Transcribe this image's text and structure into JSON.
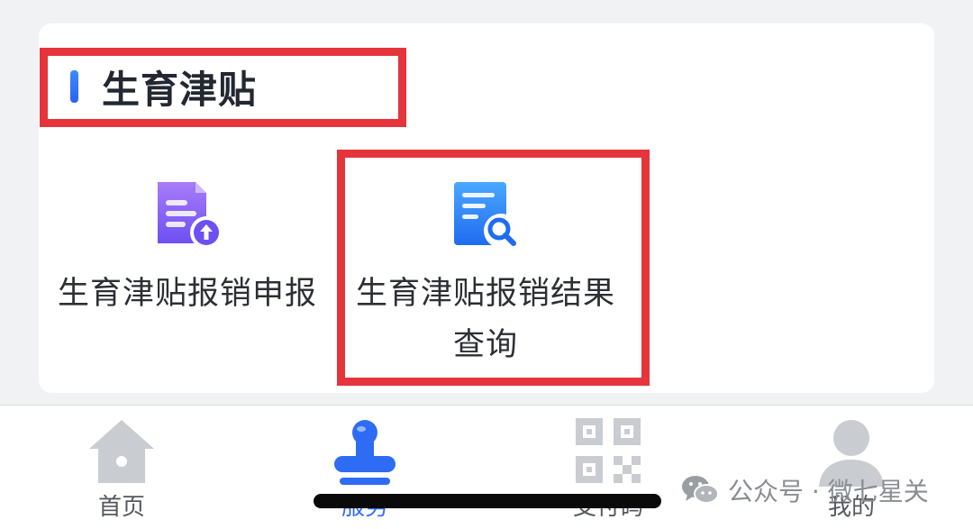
{
  "section": {
    "title": "生育津贴"
  },
  "services": [
    {
      "label": "生育津贴报销申报",
      "icon": "document-upload-icon"
    },
    {
      "label": "生育津贴报销结果查询",
      "icon": "document-search-icon"
    }
  ],
  "tabs": [
    {
      "label": "首页",
      "icon": "home-icon",
      "active": false
    },
    {
      "label": "服务",
      "icon": "stamp-icon",
      "active": true
    },
    {
      "label": "支付码",
      "icon": "qrcode-icon",
      "active": false
    },
    {
      "label": "我的",
      "icon": "user-icon",
      "active": false
    }
  ],
  "watermark": {
    "text": "公众号 · 微七星关",
    "icon": "wechat-icon"
  },
  "colors": {
    "accent": "#2f6cf4",
    "highlight": "#e5343b",
    "card": "#ffffff",
    "background": "#f1f2f4"
  }
}
